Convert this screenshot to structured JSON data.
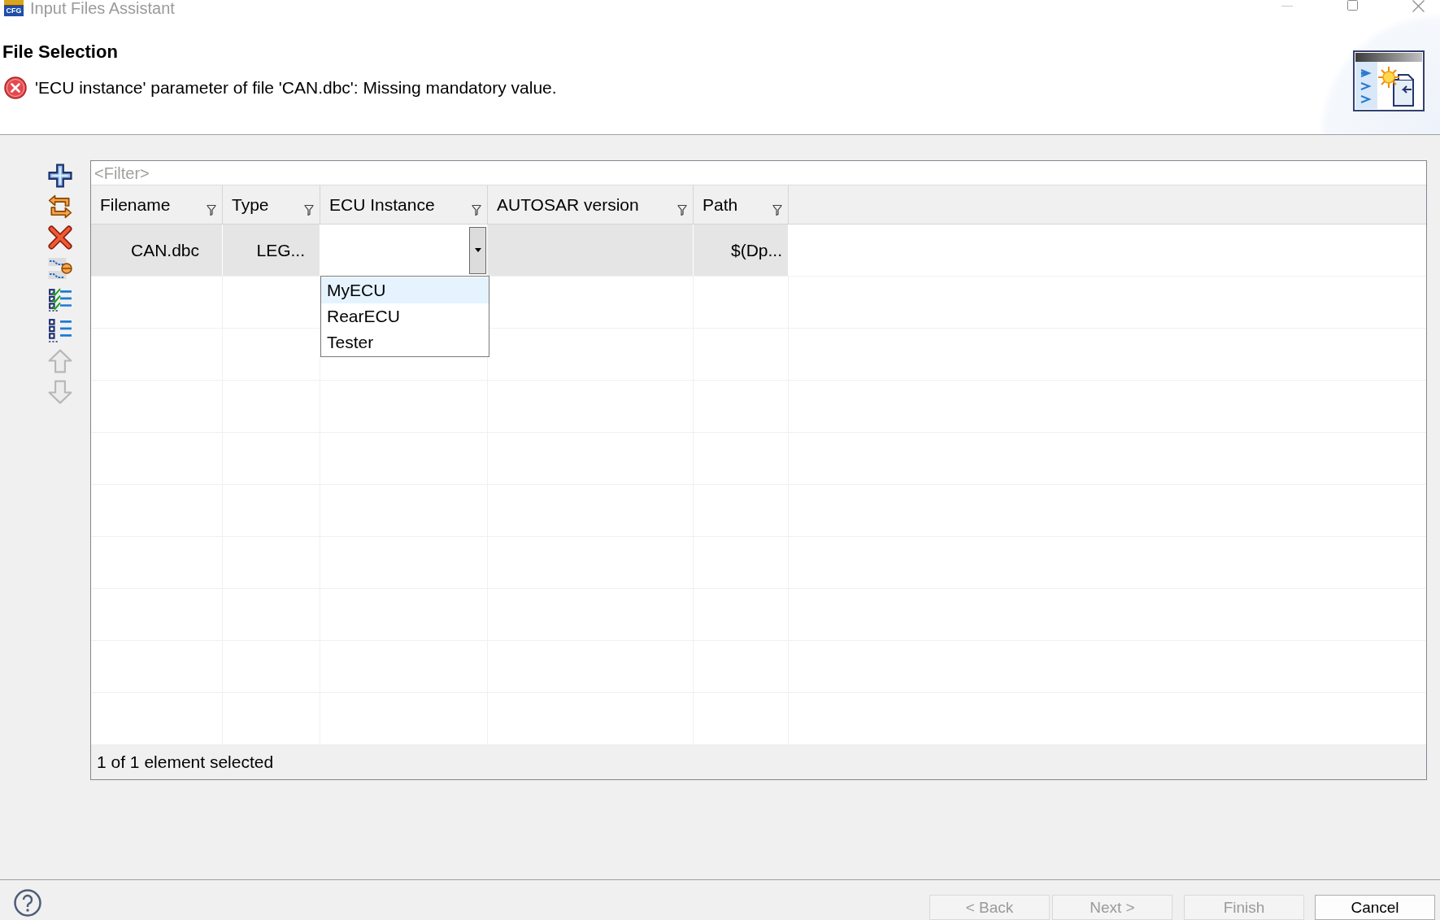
{
  "window": {
    "icon_label": "CFG",
    "title": "Input Files Assistant"
  },
  "header": {
    "title": "File Selection",
    "message": {
      "error": true,
      "text": "'ECU instance' parameter of file 'CAN.dbc': Missing mandatory value."
    }
  },
  "toolbar": [
    {
      "kind": "add",
      "disabled": false
    },
    {
      "kind": "replace",
      "disabled": false
    },
    {
      "kind": "remove",
      "disabled": false
    },
    {
      "kind": "swap_rows",
      "disabled": false
    },
    {
      "kind": "check_all",
      "disabled": false
    },
    {
      "kind": "uncheck_all",
      "disabled": false
    },
    {
      "kind": "move_up",
      "disabled": true
    },
    {
      "kind": "move_down",
      "disabled": true
    }
  ],
  "table": {
    "filter": {
      "placeholder": "<Filter>"
    },
    "columns": [
      {
        "label": "Filename"
      },
      {
        "label": "Type"
      },
      {
        "label": "ECU Instance"
      },
      {
        "label": "AUTOSAR version"
      },
      {
        "label": "Path"
      }
    ],
    "rows": [
      {
        "selected": true,
        "cells": [
          {
            "kind": "text",
            "text": "CAN.dbc"
          },
          {
            "kind": "text",
            "text": "LEG..."
          },
          {
            "kind": "combo",
            "expanded": true,
            "options": [
              {
                "label": "MyECU",
                "selected": true
              },
              {
                "label": "RearECU",
                "selected": false
              },
              {
                "label": "Tester",
                "selected": false
              }
            ]
          },
          {
            "kind": "empty"
          },
          {
            "kind": "text",
            "text": "$(Dp..."
          }
        ]
      }
    ],
    "status": "1 of 1 element selected"
  },
  "buttons": [
    {
      "label": "< Back",
      "disabled": true
    },
    {
      "label": "Next >",
      "disabled": true
    },
    {
      "label": "Finish",
      "disabled": true
    },
    {
      "label": "Cancel",
      "disabled": false
    }
  ]
}
